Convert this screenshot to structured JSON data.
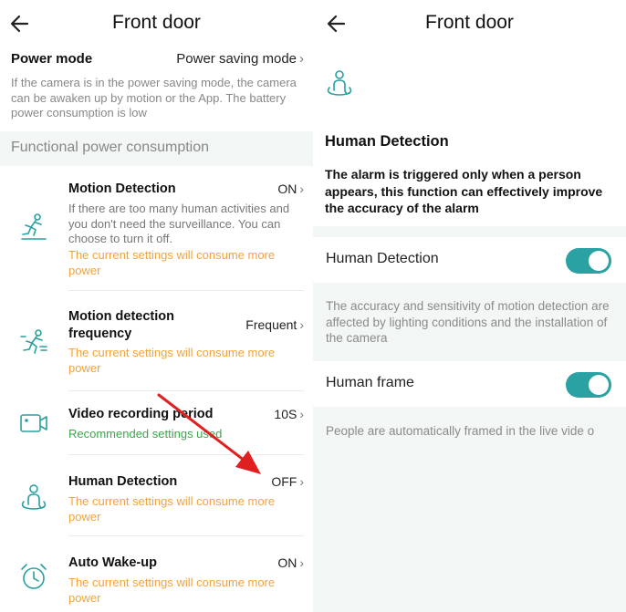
{
  "left": {
    "header": {
      "title": "Front door"
    },
    "power_mode": {
      "label": "Power mode",
      "value": "Power saving mode",
      "description": "If the camera is in the power saving mode, the camera can be awaken up by motion or the App. The battery power consumption is low"
    },
    "section_title": "Functional power consumption",
    "items": [
      {
        "name": "Motion Detection",
        "value": "ON",
        "description": "If there are too many human activities and you don't need the surveillance. You can choose to turn it off.",
        "note": "The current settings will consume more power",
        "icon": "running-person-icon"
      },
      {
        "name": "Motion detection frequency",
        "value": "Frequent",
        "note": "The current settings will consume more power",
        "icon": "sprint-person-icon"
      },
      {
        "name": "Video recording period",
        "value": "10S",
        "note": "Recommended settings used",
        "icon": "video-camera-icon"
      },
      {
        "name": "Human Detection",
        "value": "OFF",
        "note": "The current settings will consume more power",
        "icon": "human-detection-icon"
      },
      {
        "name": "Auto Wake-up",
        "value": "ON",
        "note": "The current settings will consume more power",
        "icon": "alarm-clock-icon"
      }
    ]
  },
  "right": {
    "header": {
      "title": "Front door"
    },
    "heading": "Human Detection",
    "description": "The alarm is triggered only when a person appears, this function can effectively improve the accuracy of the alarm",
    "human_detection": {
      "label": "Human Detection",
      "enabled": true,
      "note": "The accuracy and sensitivity of motion detection are affected by lighting conditions and the installation of the camera"
    },
    "human_frame": {
      "label": "Human frame",
      "enabled": true,
      "note": "People are automatically framed in the live vide o"
    }
  },
  "colors": {
    "accent": "#2aa1a3",
    "warning": "#f2a33a",
    "ok": "#3aa64b",
    "annotation_arrow": "#e02020"
  }
}
